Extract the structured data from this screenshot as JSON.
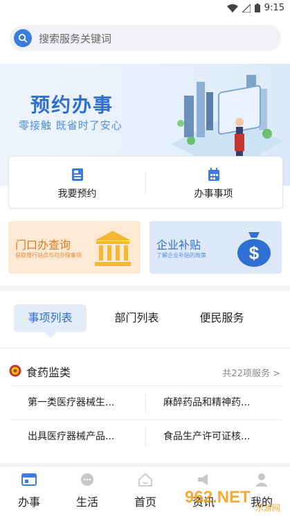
{
  "status_bar": {
    "time": "9:15"
  },
  "search": {
    "placeholder": "搜索服务关键词"
  },
  "banner": {
    "title": "预约办事",
    "subtitle": "零接触  既省时了安心"
  },
  "quick_actions": [
    {
      "label": "我要预约",
      "icon": "phone-book-icon"
    },
    {
      "label": "办事事项",
      "icon": "calendar-icon"
    }
  ],
  "promos": [
    {
      "title": "门口办查询",
      "desc": "获取银行站点与可办理事项",
      "icon": "bank-building-icon"
    },
    {
      "title": "企业补贴",
      "desc": "了解企业补贴的政策",
      "icon": "money-bag-icon"
    }
  ],
  "tabs": [
    {
      "label": "事项列表",
      "active": true
    },
    {
      "label": "部门列表",
      "active": false
    },
    {
      "label": "便民服务",
      "active": false
    }
  ],
  "category": {
    "title": "食药监类",
    "count": "共22项服务 >",
    "icon": "emblem-icon"
  },
  "services": [
    [
      "第一类医疗器械生...",
      "麻醉药品和精神药..."
    ],
    [
      "出具医疗器械产品...",
      "食品生产许可证核..."
    ]
  ],
  "bottom_nav": [
    {
      "label": "办事",
      "icon": "service-hall-icon",
      "active": true
    },
    {
      "label": "生活",
      "icon": "chat-bubble-icon",
      "active": false
    },
    {
      "label": "首页",
      "icon": "home-icon",
      "active": false
    },
    {
      "label": "资讯",
      "icon": "megaphone-icon",
      "active": false
    },
    {
      "label": "我的",
      "icon": "user-icon",
      "active": false
    }
  ],
  "watermark": {
    "text": "962.NET",
    "sub": "乐游网"
  },
  "colors": {
    "accent": "#2f6fd1",
    "promo_orange": "#e07a1f",
    "tab_active_bg": "#e3ecf9"
  }
}
